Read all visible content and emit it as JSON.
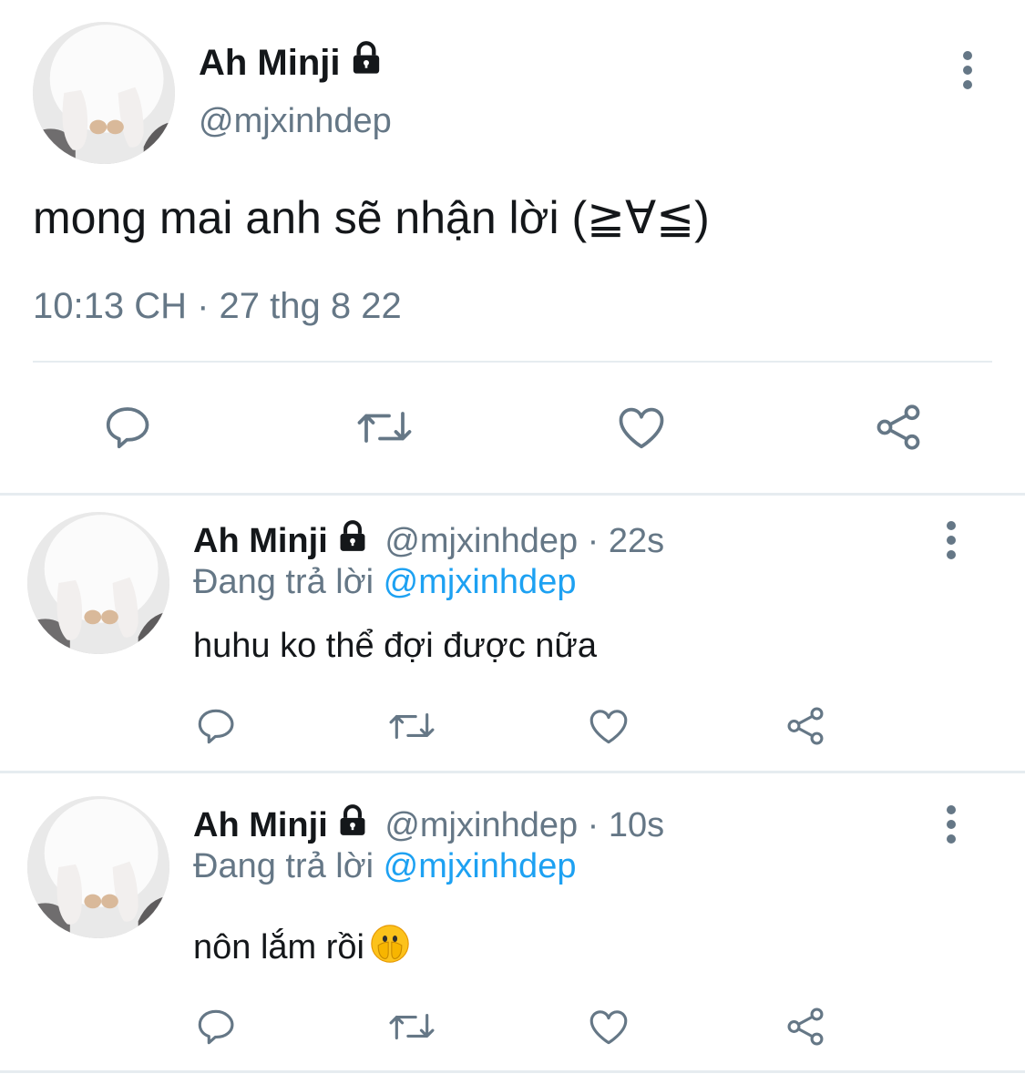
{
  "colors": {
    "text": "#14171a",
    "muted": "#657786",
    "link": "#1da1f2",
    "divider": "#e6ecf0"
  },
  "main_tweet": {
    "name": "Ah Minji",
    "handle": "@mjxinhdep",
    "text": "mong mai anh sẽ nhận lời (≧∀≦)",
    "timestamp": "10:13 CH · 27 thg 8 22",
    "icons": [
      "lock-icon",
      "more-icon",
      "reply-icon",
      "retweet-icon",
      "like-icon",
      "share-icon"
    ]
  },
  "replies": [
    {
      "name": "Ah Minji",
      "meta": "@mjxinhdep · 22s",
      "replying_prefix": "Đang trả lời",
      "replying_to": "@mjxinhdep",
      "text": "huhu ko thể đợi được nữa",
      "emoji": ""
    },
    {
      "name": "Ah Minji",
      "meta": "@mjxinhdep · 10s",
      "replying_prefix": "Đang trả lời",
      "replying_to": "@mjxinhdep",
      "text": "nôn lắm rồi",
      "emoji": "face-with-open-eyes-and-hand-over-mouth"
    }
  ]
}
